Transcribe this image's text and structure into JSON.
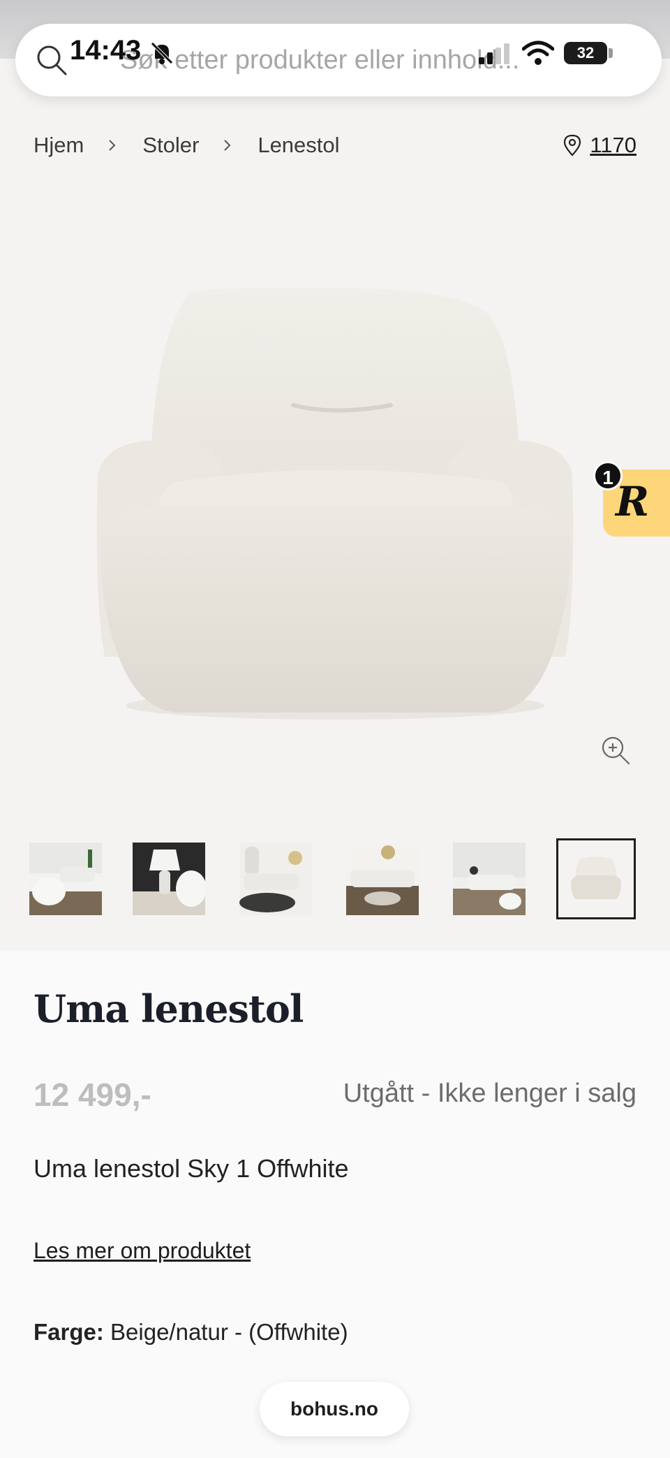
{
  "status_bar": {
    "time": "14:43",
    "battery": "32"
  },
  "search": {
    "placeholder": "Søk etter produkter eller innhold..."
  },
  "breadcrumb": {
    "items": [
      "Hjem",
      "Stoler",
      "Lenestol"
    ]
  },
  "store": {
    "label": "1170"
  },
  "badge": {
    "letter": "R",
    "count": "1"
  },
  "gallery": {
    "thumbnails": [
      "living-room",
      "lamp-table",
      "living-room-2",
      "living-room-3",
      "living-room-4",
      "armchair"
    ],
    "selected_index": 5
  },
  "product": {
    "title": "Uma lenestol",
    "price": "12 499,-",
    "status": "Utgått - Ikke lenger i salg",
    "variant": "Uma lenestol Sky 1 Offwhite",
    "read_more": "Les mer om produktet",
    "color_label": "Farge:",
    "color_value": "Beige/natur - (Offwhite)"
  },
  "footer": {
    "domain": "bohus.no"
  },
  "colors": {
    "badge": "#fcd679",
    "background": "#f5f3f2",
    "price_muted": "#bdbdbd"
  }
}
